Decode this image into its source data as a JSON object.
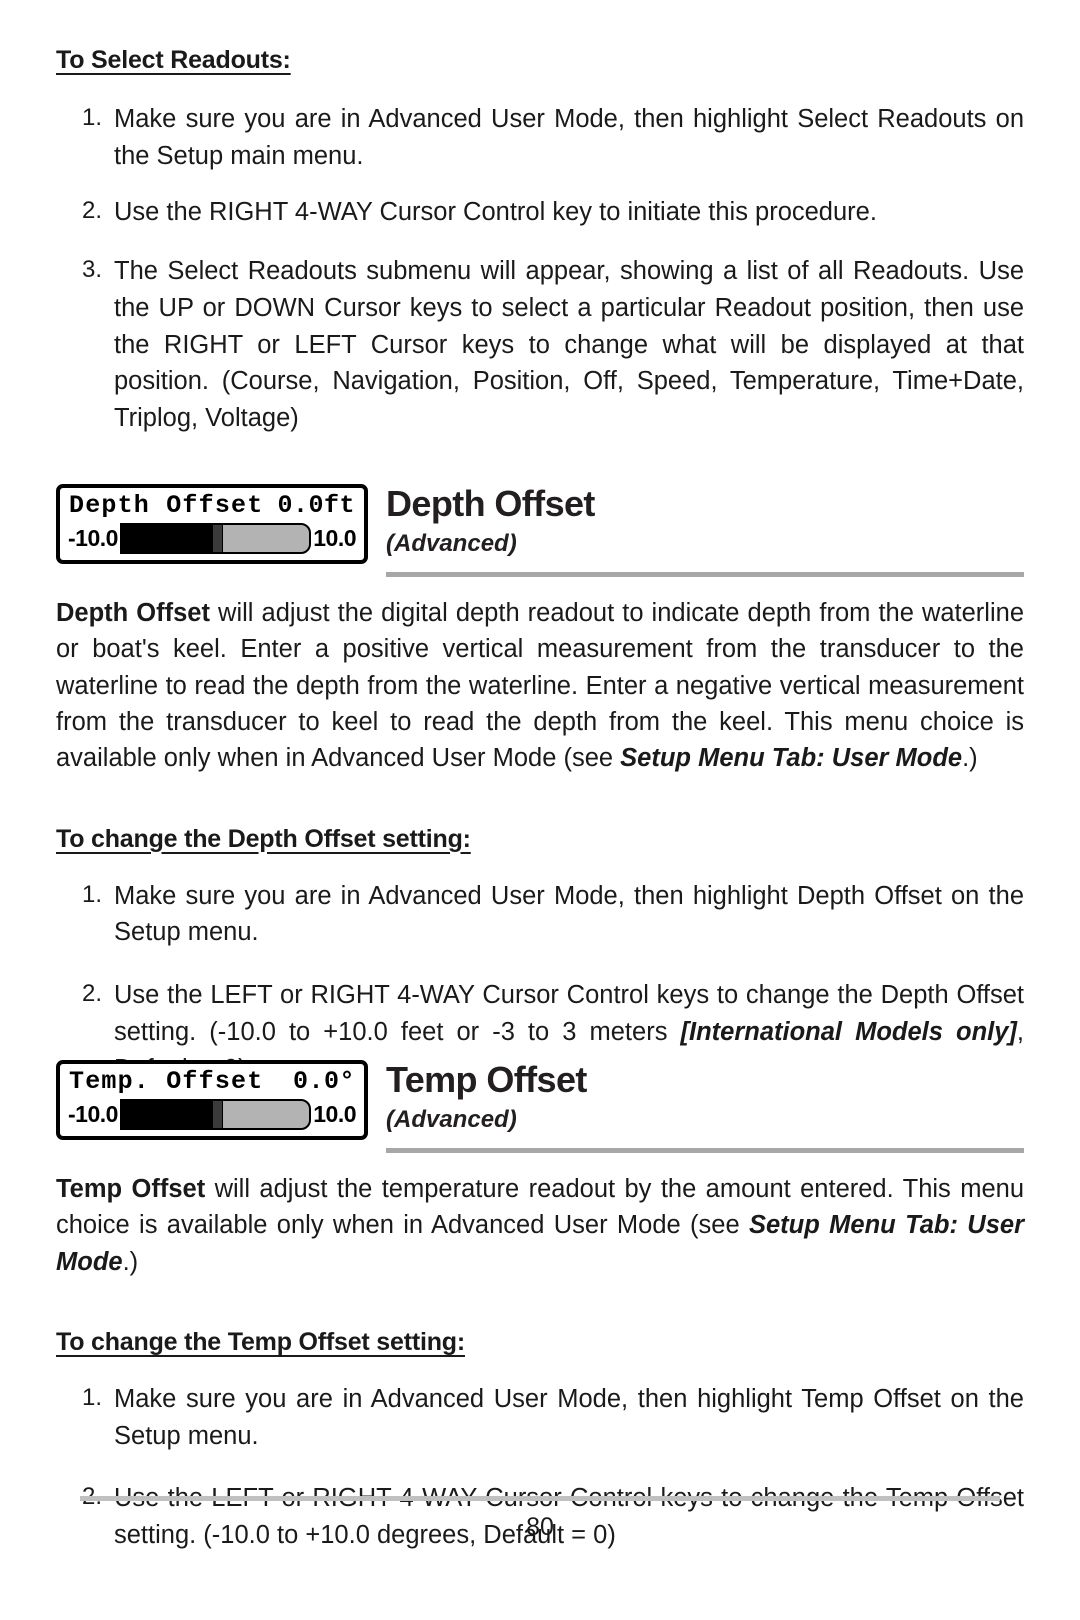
{
  "page": {
    "number": "80"
  },
  "select_readouts": {
    "heading": "To Select Readouts:",
    "steps": [
      {
        "num": "1.",
        "text": "Make sure you are in Advanced User Mode, then highlight Select Readouts on the Setup main menu."
      },
      {
        "num": "2.",
        "text": "Use the RIGHT 4-WAY Cursor Control key to initiate this procedure."
      },
      {
        "num": "3.",
        "text": "The Select Readouts submenu will appear, showing a list of all Readouts. Use the UP or DOWN Cursor keys to select a particular Readout position, then use the RIGHT or LEFT Cursor keys to change what will be displayed at that position. (Course, Navigation, Position, Off, Speed, Temperature, Time+Date, Triplog, Voltage)"
      }
    ]
  },
  "depth_offset": {
    "lcd": {
      "label": "Depth Offset",
      "value": "0.0ft",
      "min": "-10.0",
      "max": "10.0",
      "fill_percent": 50
    },
    "title": "Depth Offset",
    "subtitle": "(Advanced)",
    "body": {
      "lead": "Depth Offset",
      "text_1": " will adjust the digital depth readout to indicate depth from the waterline or boat's keel. Enter a positive vertical measurement from the transducer to the waterline to read the depth from the waterline. Enter a negative vertical measurement from the transducer to keel to read the depth from the keel. This menu choice is available only when in Advanced User Mode (see ",
      "reference": "Setup Menu Tab: User Mode",
      "text_2": ".)"
    },
    "howto": {
      "heading": "To change the Depth Offset setting:",
      "steps": [
        {
          "num": "1.",
          "text": "Make sure you are in Advanced User Mode, then highlight Depth Offset on the Setup menu."
        },
        {
          "num": "2.",
          "text_1": "Use the LEFT or RIGHT 4-WAY Cursor Control keys to change the Depth Offset setting. (-10.0 to +10.0 feet or -3 to 3 meters ",
          "emphasis": "[International Models only]",
          "text_2": ", Default = 0)"
        }
      ]
    }
  },
  "temp_offset": {
    "lcd": {
      "label": "Temp. Offset",
      "value": "0.0°",
      "min": "-10.0",
      "max": "10.0",
      "fill_percent": 50
    },
    "title": "Temp Offset",
    "subtitle": "(Advanced)",
    "body": {
      "lead": "Temp Offset",
      "text_1": " will adjust the temperature readout by the amount entered. This menu choice is available only when in Advanced User Mode  (see ",
      "reference": "Setup Menu Tab: User Mode",
      "text_2": ".)"
    },
    "howto": {
      "heading": "To change the Temp Offset setting:",
      "steps": [
        {
          "num": "1.",
          "text": "Make sure you are in Advanced User Mode, then highlight Temp Offset on the Setup menu."
        },
        {
          "num": "2.",
          "text": "Use the LEFT or RIGHT 4-WAY Cursor Control keys to change the Temp Offset setting. (-10.0 to +10.0 degrees, Default = 0)"
        }
      ]
    }
  }
}
